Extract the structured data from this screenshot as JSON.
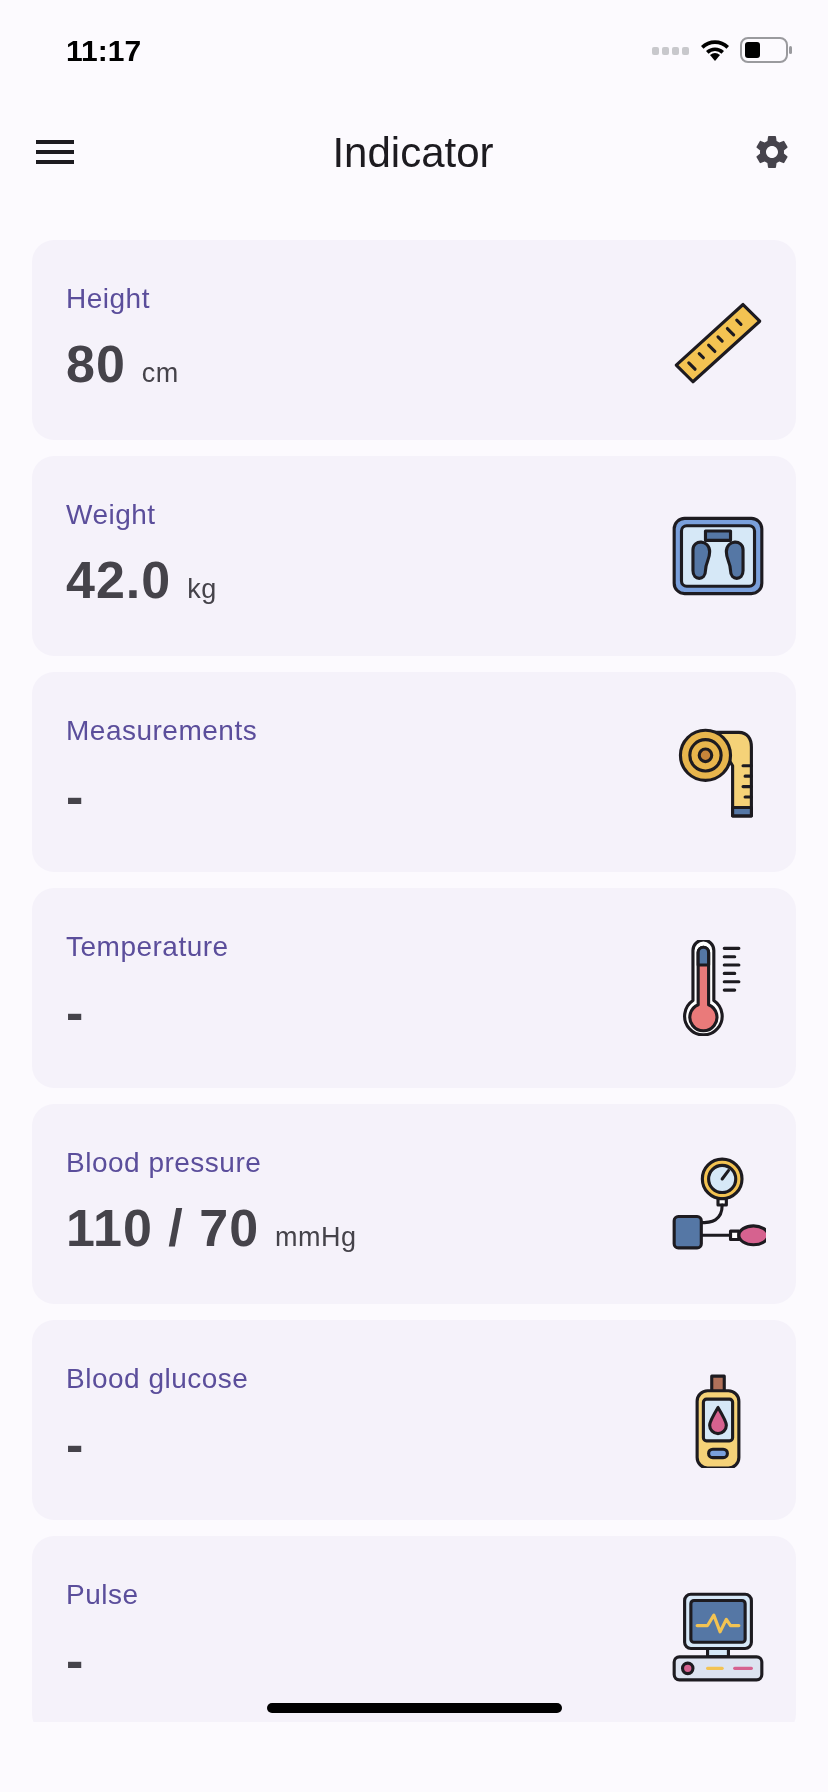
{
  "status_bar": {
    "time": "11:17"
  },
  "header": {
    "title": "Indicator"
  },
  "cards": [
    {
      "label": "Height",
      "value": "80",
      "unit": "cm"
    },
    {
      "label": "Weight",
      "value": "42.0",
      "unit": "kg"
    },
    {
      "label": "Measurements",
      "value": "-"
    },
    {
      "label": "Temperature",
      "value": "-"
    },
    {
      "label": "Blood pressure",
      "value": "110 / 70",
      "unit": "mmHg"
    },
    {
      "label": "Blood glucose",
      "value": "-"
    },
    {
      "label": "Pulse",
      "value": "-"
    }
  ]
}
